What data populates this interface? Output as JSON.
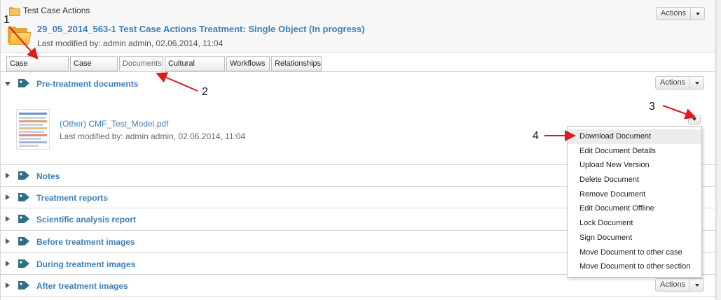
{
  "header": {
    "breadcrumb": "Test Case Actions",
    "case_title": "29_05_2014_563-1 Test Case Actions Treatment: Single Object (In progress)",
    "case_meta": "Last modified by: admin admin, 02.06.2014, 11:04",
    "actions_label": "Actions"
  },
  "tabs": [
    {
      "label": "Case dashboard"
    },
    {
      "label": "Case details"
    },
    {
      "label": "Documents"
    },
    {
      "label": "Cultural Objects"
    },
    {
      "label": "Workflows"
    },
    {
      "label": "Relationships"
    }
  ],
  "sections": {
    "pretreatment": {
      "title": "Pre-treatment documents",
      "actions_label": "Actions",
      "document": {
        "title": "(Other) CMF_Test_Model.pdf",
        "meta": "Last modified by: admin admin, 02.06.2014, 11:04"
      }
    },
    "notes": {
      "title": "Notes"
    },
    "treatment_reports": {
      "title": "Treatment reports"
    },
    "scientific": {
      "title": "Scientific analysis report"
    },
    "before_images": {
      "title": "Before treatment images"
    },
    "during_images": {
      "title": "During treatment images"
    },
    "after_images": {
      "title": "After treatment images",
      "actions_label": "Actions"
    }
  },
  "menu": {
    "items": [
      "Download Document",
      "Edit Document Details",
      "Upload New Version",
      "Delete Document",
      "Remove Document",
      "Edit Document Offline",
      "Lock Document",
      "Sign Document",
      "Move Document to other case",
      "Move Document to other section"
    ]
  },
  "annotations": {
    "n1": "1",
    "n2": "2",
    "n3": "3",
    "n4": "4",
    "color": "#e0191f"
  },
  "colors": {
    "link": "#3d7fb8",
    "tag_icon": "#2f6f86",
    "folder": "#f5c55a"
  }
}
